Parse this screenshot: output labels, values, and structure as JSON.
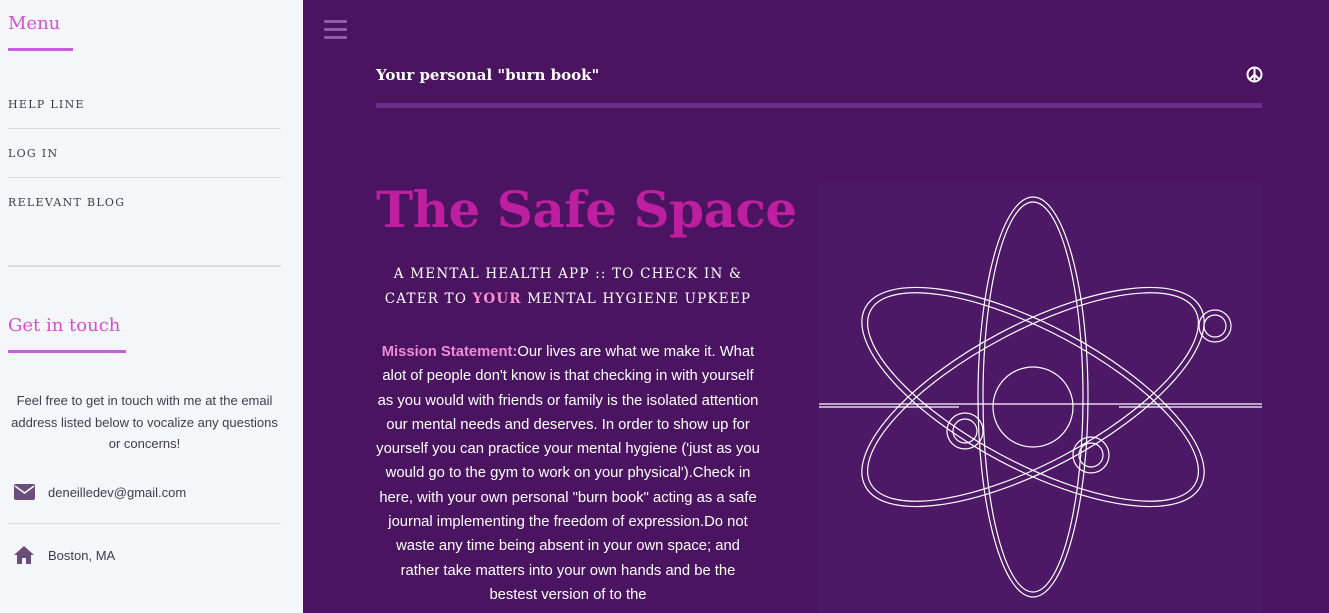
{
  "sidebar": {
    "menu_heading": "Menu",
    "menu_items": [
      {
        "label": "HELP LINE"
      },
      {
        "label": "LOG IN"
      },
      {
        "label": "RELEVANT BLOG"
      }
    ],
    "touch_heading": "Get in touch",
    "touch_text": "Feel free to get in touch with me at the email address listed below to vocalize any questions or concerns!",
    "contact": {
      "email_icon": "envelope-icon",
      "email": "deneilledev@gmail.com",
      "location_icon": "home-icon",
      "location": "Boston, MA"
    }
  },
  "header": {
    "menu_icon": "hamburger-icon",
    "title": "Your personal \"burn book\"",
    "peace_icon": "peace-icon"
  },
  "hero": {
    "title": "The Safe Space",
    "subtitle_line1": "A MENTAL HEALTH APP :: TO CHECK IN &",
    "subtitle_pre": "CATER TO ",
    "subtitle_em": "YOUR",
    "subtitle_post": " MENTAL HYGIENE UPKEEP",
    "mission_label": "Mission Statement:",
    "mission_text": "Our lives are what we make it. What alot of people don't know is that checking in with yourself as you would with friends or family is the isolated attention our mental needs and deserves. In order to show up for yourself you can practice your mental hygiene ('just as you would go to the gym to work on your physical').Check in here, with your own personal \"burn book\" acting as a safe journal implementing the freedom of expression.Do not waste any time being absent in your own space; and rather take matters into your own hands and be the bestest version of to the ",
    "image_icon": "atom-icon"
  },
  "colors": {
    "accent_pink": "#d84fd3",
    "hero_title": "#bd1fa0",
    "main_bg": "#4a1460",
    "sidebar_bg": "#f5f6fa",
    "highlight": "#ff8fd4"
  }
}
